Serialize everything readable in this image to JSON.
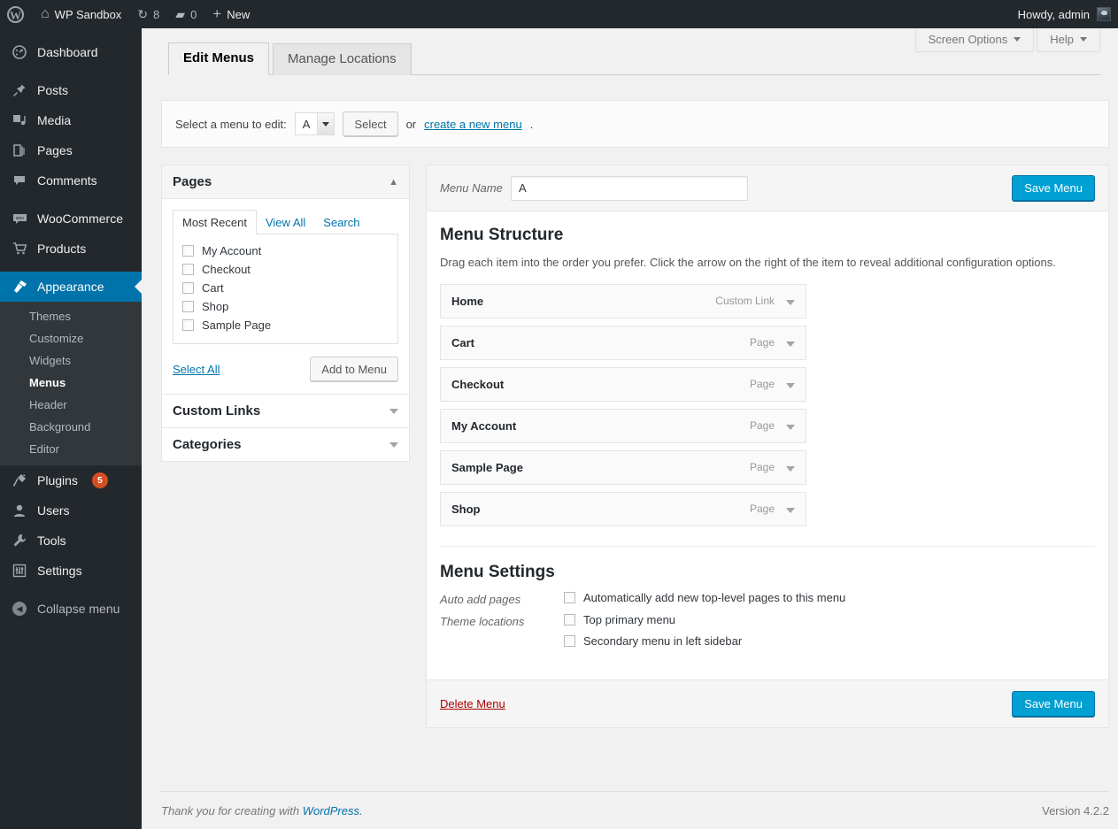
{
  "adminbar": {
    "logo_icon": "wordpress-logo-icon",
    "site_name": "WP Sandbox",
    "home_icon": "home-icon",
    "updates_icon": "updates-icon",
    "updates_count": "8",
    "comments_icon": "comment-bubble-icon",
    "comments_count": "0",
    "new_icon": "plus-icon",
    "new_label": "New",
    "howdy": "Howdy, admin",
    "avatar_icon": "user-avatar"
  },
  "sidebar": {
    "items": [
      {
        "label": "Dashboard",
        "icon": "dashboard-icon"
      },
      {
        "label": "Posts",
        "icon": "pin-icon"
      },
      {
        "label": "Media",
        "icon": "media-icon"
      },
      {
        "label": "Pages",
        "icon": "pages-icon"
      },
      {
        "label": "Comments",
        "icon": "comment-icon"
      },
      {
        "label": "WooCommerce",
        "icon": "woocommerce-icon"
      },
      {
        "label": "Products",
        "icon": "cart-icon"
      },
      {
        "label": "Appearance",
        "icon": "brush-icon"
      },
      {
        "label": "Plugins",
        "icon": "plug-icon",
        "badge": "5"
      },
      {
        "label": "Users",
        "icon": "user-icon"
      },
      {
        "label": "Tools",
        "icon": "wrench-icon"
      },
      {
        "label": "Settings",
        "icon": "sliders-icon"
      }
    ],
    "submenu": [
      {
        "label": "Themes"
      },
      {
        "label": "Customize"
      },
      {
        "label": "Widgets"
      },
      {
        "label": "Menus"
      },
      {
        "label": "Header"
      },
      {
        "label": "Background"
      },
      {
        "label": "Editor"
      }
    ],
    "collapse_label": "Collapse menu",
    "collapse_icon": "collapse-arrow-icon"
  },
  "screen_meta": {
    "screen_options": "Screen Options",
    "help": "Help",
    "caret_icon": "chevron-down-icon"
  },
  "tabs": [
    {
      "label": "Edit Menus",
      "active": true
    },
    {
      "label": "Manage Locations",
      "active": false
    }
  ],
  "menu_selector": {
    "label": "Select a menu to edit:",
    "selected": "A",
    "select_button": "Select",
    "or_text": "or",
    "create_link": "create a new menu",
    "period": ".",
    "dropdown_icon": "chevron-down-icon"
  },
  "panels": [
    {
      "title": "Pages",
      "open": true,
      "toggle_icon": "chevron-up-icon",
      "tabs": [
        {
          "label": "Most Recent",
          "active": true
        },
        {
          "label": "View All",
          "active": false
        },
        {
          "label": "Search",
          "active": false
        }
      ],
      "items": [
        {
          "label": "My Account",
          "checked": false
        },
        {
          "label": "Checkout",
          "checked": false
        },
        {
          "label": "Cart",
          "checked": false
        },
        {
          "label": "Shop",
          "checked": false
        },
        {
          "label": "Sample Page",
          "checked": false
        }
      ],
      "select_all": "Select All",
      "add_button": "Add to Menu"
    },
    {
      "title": "Custom Links",
      "open": false,
      "toggle_icon": "chevron-down-icon"
    },
    {
      "title": "Categories",
      "open": false,
      "toggle_icon": "chevron-down-icon"
    }
  ],
  "menu_edit": {
    "name_label": "Menu Name",
    "name_value": "A",
    "save_label": "Save Menu",
    "structure_title": "Menu Structure",
    "structure_desc": "Drag each item into the order you prefer. Click the arrow on the right of the item to reveal additional configuration options.",
    "items": [
      {
        "name": "Home",
        "type": "Custom Link"
      },
      {
        "name": "Cart",
        "type": "Page"
      },
      {
        "name": "Checkout",
        "type": "Page"
      },
      {
        "name": "My Account",
        "type": "Page"
      },
      {
        "name": "Sample Page",
        "type": "Page"
      },
      {
        "name": "Shop",
        "type": "Page"
      }
    ],
    "settings_title": "Menu Settings",
    "auto_add_label": "Auto add pages",
    "auto_add_option": "Automatically add new top-level pages to this menu",
    "theme_locations_label": "Theme locations",
    "theme_locations": [
      {
        "label": "Top primary menu",
        "checked": false
      },
      {
        "label": "Secondary menu in left sidebar",
        "checked": false
      }
    ],
    "delete_label": "Delete Menu",
    "save_label_bottom": "Save Menu"
  },
  "footer": {
    "thanks_prefix": "Thank you for creating with",
    "wordpress_link": "WordPress.",
    "version": "Version 4.2.2"
  },
  "colors": {
    "sidebar_bg": "#23282d",
    "submenu_bg": "#32373c",
    "current_blue": "#0073aa",
    "primary_button": "#00a0d2",
    "badge_orange": "#d54e21",
    "link_blue": "#0073aa",
    "delete_red": "#a00"
  }
}
